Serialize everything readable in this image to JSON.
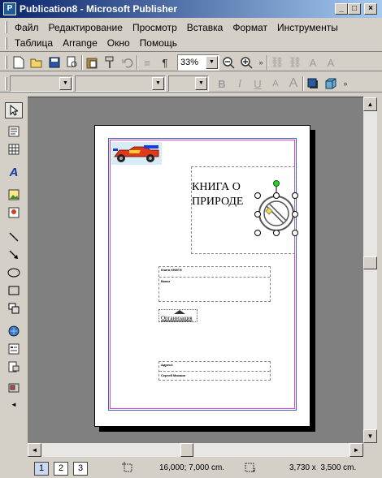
{
  "window": {
    "title": "Publication8 - Microsoft Publisher",
    "app_icon": "publisher-icon",
    "controls": {
      "minimize": "_",
      "maximize": "□",
      "close": "×"
    }
  },
  "menu": {
    "row1": [
      "Файл",
      "Редактирование",
      "Просмотр",
      "Вставка",
      "Формат",
      "Инструменты"
    ],
    "row2": [
      "Таблица",
      "Arrange",
      "Окно",
      "Помощь"
    ]
  },
  "standard_toolbar": {
    "zoom_value": "33%",
    "icons": [
      "new-icon",
      "open-icon",
      "save-icon",
      "print-preview-icon",
      "paste-icon",
      "format-painter-icon",
      "undo-icon",
      "columns-icon",
      "pilcrow-icon",
      "zoom-out-icon",
      "zoom-in-icon",
      "more-icon",
      "link-icon",
      "unlink-icon",
      "text-flow-icon",
      "text-flow-back-icon"
    ]
  },
  "format_toolbar": {
    "style_value": "",
    "font_value": "",
    "size_value": "",
    "labels": {
      "bold": "B",
      "italic": "I",
      "underline": "U",
      "font_shrink": "A",
      "font_grow": "A"
    }
  },
  "left_toolbar": {
    "icons": [
      "pointer-icon",
      "text-box-icon",
      "table-icon",
      "wordart-icon",
      "picture-icon",
      "clipart-icon",
      "line-icon",
      "arrow-icon",
      "oval-icon",
      "rectangle-icon",
      "autoshapes-icon",
      "hot-spot-icon",
      "form-control-icon",
      "html-fragment-icon",
      "design-gallery-icon",
      "more-tools-icon"
    ]
  },
  "document": {
    "title_text": "КНИГА О ПРИРОДЕ",
    "org_text": "Организация",
    "small_labels": [
      "Книга КНИГИ",
      "Вкниг",
      "Адрес4",
      "Сергей Михаил"
    ]
  },
  "statusbar": {
    "pages": [
      "1",
      "2",
      "3"
    ],
    "current_page": "1",
    "position": "16,000; 7,000 cm.",
    "size": "3,730 x  3,500 cm."
  }
}
